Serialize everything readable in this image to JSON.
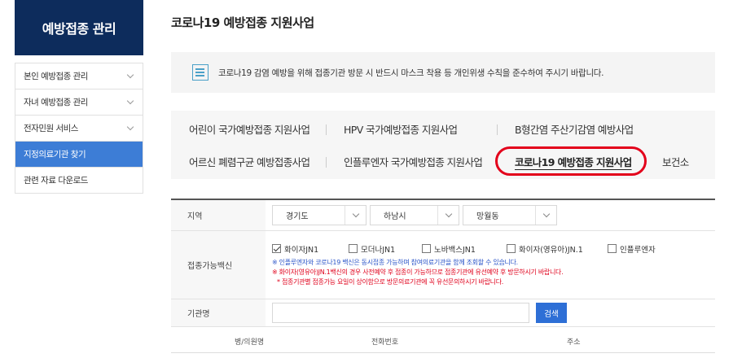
{
  "sidebar": {
    "title": "예방접종 관리",
    "items": [
      {
        "label": "본인 예방접종 관리",
        "has_chevron": true,
        "active": false
      },
      {
        "label": "자녀 예방접종 관리",
        "has_chevron": true,
        "active": false
      },
      {
        "label": "전자민원 서비스",
        "has_chevron": true,
        "active": false
      },
      {
        "label": "지정의료기관 찾기",
        "has_chevron": false,
        "active": true
      },
      {
        "label": "관련 자료 다운로드",
        "has_chevron": false,
        "active": false
      }
    ]
  },
  "page": {
    "title": "코로나19 예방접종 지원사업"
  },
  "notice": {
    "icon": "document-list-icon",
    "text": "코로나19 감염 예방을 위해 접종기관 방문 시 반드시 마스크 착용 등 개인위생 수칙을 준수하여 주시기 바랍니다."
  },
  "tabs": {
    "row1": [
      "어린이 국가예방접종 지원사업",
      "HPV 국가예방접종 지원사업",
      "B형간염 주산기감염 예방사업"
    ],
    "row2": [
      "어르신 폐렴구균 예방접종사업",
      "인플루엔자 국가예방접종 지원사업",
      "코로나19 예방접종 지원사업",
      "보건소"
    ],
    "current": "코로나19 예방접종 지원사업",
    "highlight_color": "#e3001b"
  },
  "form": {
    "region_label": "지역",
    "province": "경기도",
    "city": "하남시",
    "district": "망월동",
    "vaccine_label": "접종가능백신",
    "vaccines": [
      {
        "label": "화이자JN1",
        "checked": true
      },
      {
        "label": "모더나JN1",
        "checked": false
      },
      {
        "label": "노바백스JN1",
        "checked": false
      },
      {
        "label": "화이자(영유아)JN.1",
        "checked": false
      },
      {
        "label": "인플루엔자",
        "checked": false
      }
    ],
    "notes": {
      "blue": "※ 인플루엔자와 코로나19 백신은 동시접종 가능하며 참여의료기관을 함께 조회할 수 있습니다.",
      "red1": "※ 화이자(영유아)JN.1백신의 경우 사전예약 후 접종이 가능하므로 접종기관에 유선예약 후 방문하시기 바랍니다.",
      "red2": "* 접종기관별 접종가능 요일이 상이함으로 방문의료기관에 꼭 유선문의하시기 바랍니다."
    },
    "org_label": "기관명",
    "org_value": "",
    "search_label": "검색"
  },
  "list": {
    "columns": [
      "병/의원명",
      "전화번호",
      "주소"
    ]
  },
  "colors": {
    "sidebar_header": "#0d2c5c",
    "sidebar_active": "#3d7dd6",
    "search_button": "#2e6fd6",
    "note_blue": "#2b55c8",
    "note_red": "#e0001b"
  }
}
